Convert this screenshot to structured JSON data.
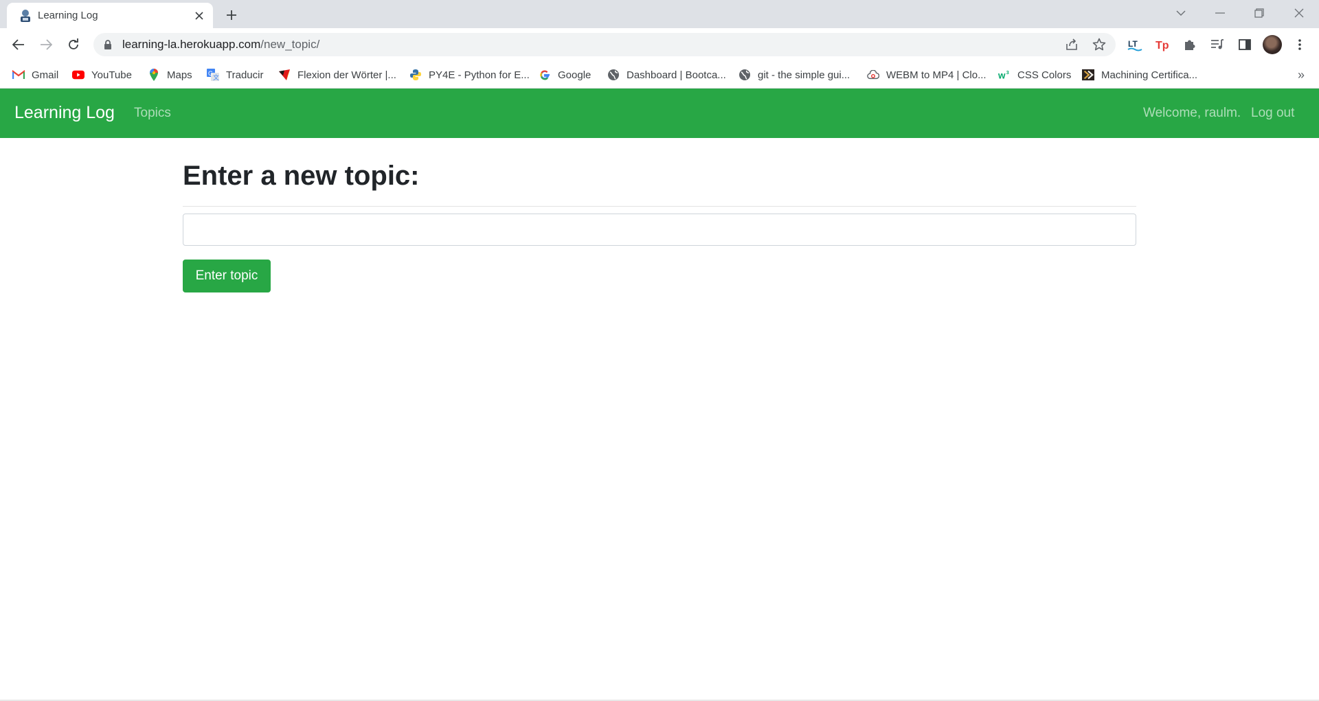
{
  "browser": {
    "tab": {
      "title": "Learning Log"
    },
    "url": {
      "host": "learning-la.herokuapp.com",
      "path": "/new_topic/"
    },
    "bookmarks": [
      {
        "label": "Gmail",
        "icon": "gmail-icon"
      },
      {
        "label": "YouTube",
        "icon": "youtube-icon"
      },
      {
        "label": "Maps",
        "icon": "maps-icon"
      },
      {
        "label": "Traducir",
        "icon": "translate-icon"
      },
      {
        "label": "Flexion der Wörter |...",
        "icon": "flexion-icon"
      },
      {
        "label": "PY4E - Python for E...",
        "icon": "python-icon"
      },
      {
        "label": "Google",
        "icon": "google-icon"
      },
      {
        "label": "Dashboard | Bootca...",
        "icon": "globe-icon"
      },
      {
        "label": "git - the simple gui...",
        "icon": "globe-icon"
      },
      {
        "label": "WEBM to MP4 | Clo...",
        "icon": "cloudconvert-icon"
      },
      {
        "label": "CSS Colors",
        "icon": "w3schools-icon"
      },
      {
        "label": "Machining Certifica...",
        "icon": "machining-icon"
      }
    ],
    "more_bookmarks": "»"
  },
  "navbar": {
    "brand": "Learning Log",
    "topics": "Topics",
    "welcome": "Welcome, raulm.",
    "logout": "Log out",
    "color": "#28a745"
  },
  "main": {
    "title": "Enter a new topic:",
    "topic_input": {
      "value": "",
      "placeholder": ""
    },
    "submit_label": "Enter topic"
  }
}
